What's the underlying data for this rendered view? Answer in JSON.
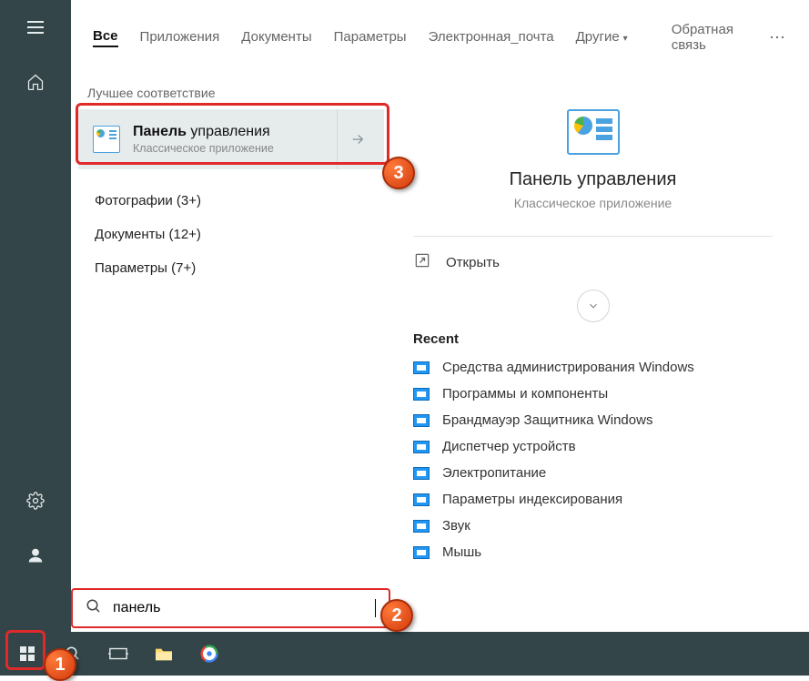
{
  "header": {
    "tabs": [
      "Все",
      "Приложения",
      "Документы",
      "Параметры",
      "Электронная_почта"
    ],
    "more_label": "Другие",
    "feedback": "Обратная связь"
  },
  "results": {
    "section_label": "Лучшее соответствие",
    "best": {
      "title_bold": "Панель",
      "title_rest": " управления",
      "sub": "Классическое приложение"
    },
    "links": [
      "Фотографии (3+)",
      "Документы (12+)",
      "Параметры (7+)"
    ]
  },
  "detail": {
    "title": "Панель управления",
    "sub": "Классическое приложение",
    "open_label": "Открыть",
    "recent_label": "Recent",
    "recent": [
      "Средства администрирования Windows",
      "Программы и компоненты",
      "Брандмауэр Защитника Windows",
      "Диспетчер устройств",
      "Электропитание",
      "Параметры индексирования",
      "Звук",
      "Мышь"
    ]
  },
  "search": {
    "value": "панель",
    "placeholder": ""
  },
  "annotations": {
    "b1": "1",
    "b2": "2",
    "b3": "3"
  }
}
